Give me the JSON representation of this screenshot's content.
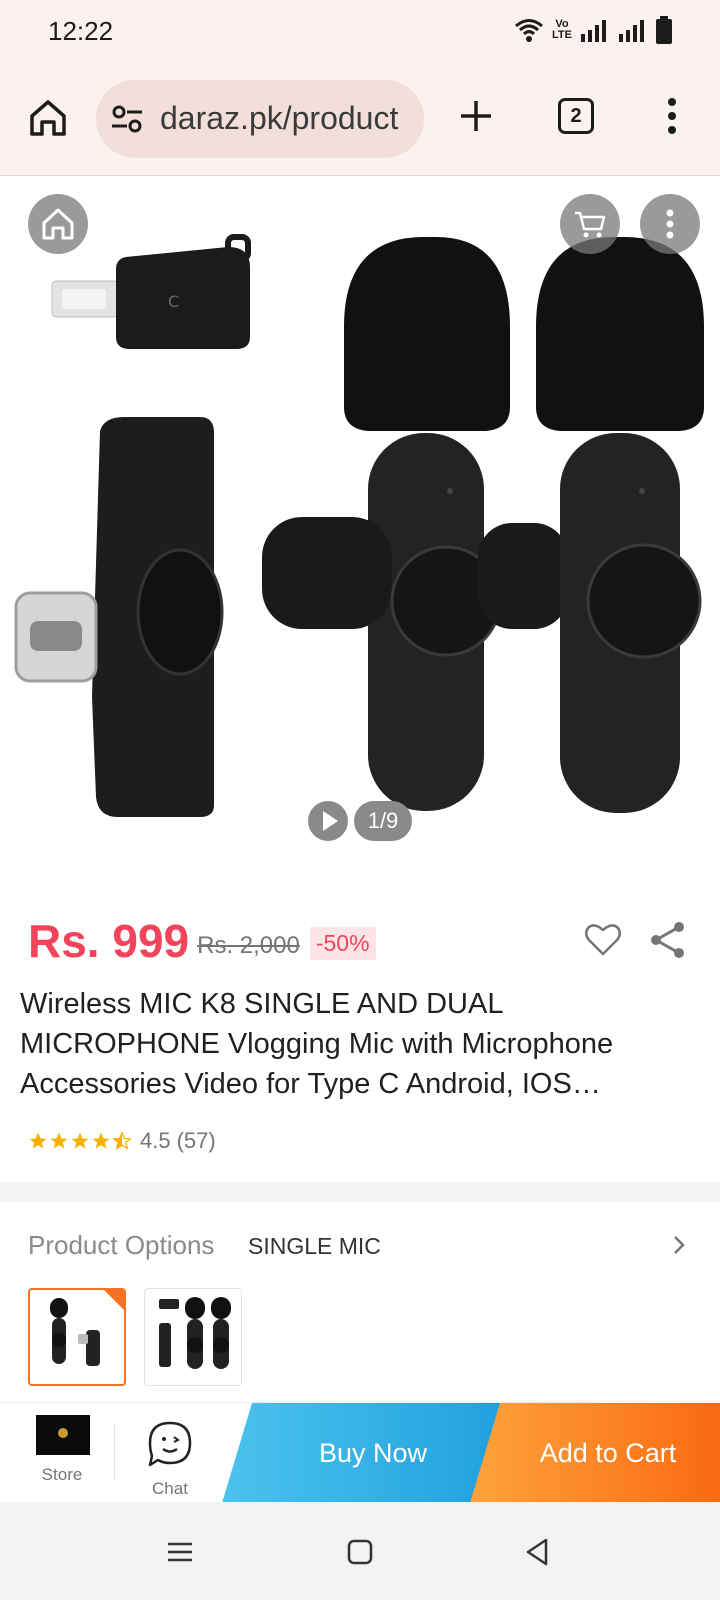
{
  "status_bar": {
    "time": "12:22",
    "volte_line1": "Vo",
    "volte_line2": "LTE"
  },
  "browser": {
    "url": "daraz.pk/product",
    "tab_count": "2"
  },
  "gallery": {
    "counter": "1/9"
  },
  "product": {
    "price": "Rs. 999",
    "original_price": "Rs. 2,000",
    "discount": "-50%",
    "title": "Wireless MIC K8 SINGLE AND DUAL MICROPHONE Vlogging Mic with Microphone Accessories Video for Type C Android, IOS…",
    "rating_value": 4.5,
    "rating": "4.5",
    "reviews": "(57)"
  },
  "options": {
    "label": "Product Options",
    "selected": "SINGLE MIC"
  },
  "actions": {
    "store": "Store",
    "chat": "Chat",
    "buy_now": "Buy Now",
    "add_to_cart": "Add to Cart"
  },
  "colors": {
    "price": "#f1435a",
    "buy_now": "#29aee4",
    "add_to_cart": "#f97a1f",
    "star": "#f6b100"
  }
}
